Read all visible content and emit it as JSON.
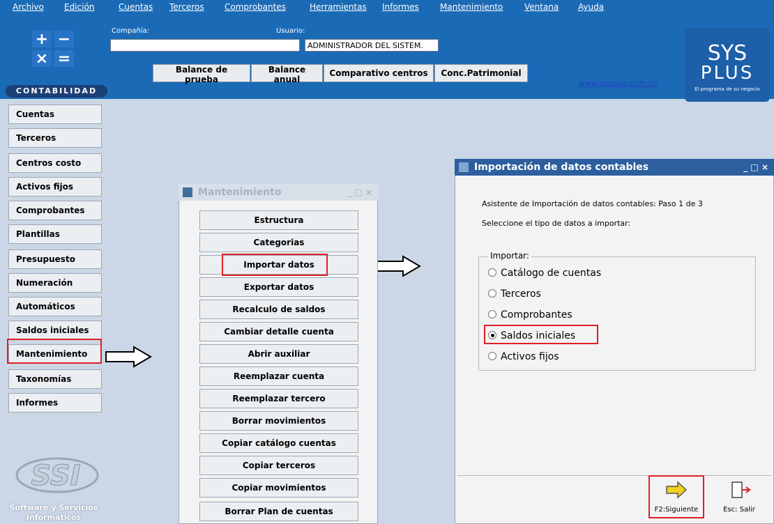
{
  "menubar": {
    "items": [
      "Archivo",
      "Edición",
      "Cuentas",
      "Terceros",
      "Comprobantes",
      "Herramientas",
      "Informes",
      "Mantenimiento",
      "Ventana",
      "Ayuda"
    ]
  },
  "header": {
    "company_label": "Compañía:",
    "user_label": "Usuario:",
    "company_value": "",
    "user_value": "ADMINISTRADOR DEL SISTEM.",
    "buttons": [
      "Balance de prueba",
      "Balance anual",
      "Comparativo centros",
      "Conc.Patrimonial"
    ],
    "link": "www.sysplus.com.co",
    "brand": {
      "sys": "SYS",
      "plus": "PLUS",
      "tag": "El programa de su negocio"
    }
  },
  "sidebar": {
    "section": "CONTABILIDAD",
    "items": [
      "Cuentas",
      "Terceros",
      "Centros costo",
      "Activos fijos",
      "Comprobantes",
      "Plantillas",
      "Presupuesto",
      "Numeración",
      "Automáticos",
      "Saldos iniciales",
      "Mantenimiento",
      "Taxonomías",
      "Informes"
    ],
    "footer_logo": "SSI",
    "footer_text1": "Software y Servicios",
    "footer_text2": "Informáticos"
  },
  "maint_window": {
    "title": "Mantenimiento",
    "buttons": [
      "Estructura",
      "Categorias",
      "Importar datos",
      "Exportar datos",
      "Recalculo de saldos",
      "Cambiar detalle cuenta",
      "Abrir auxiliar",
      "Reemplazar cuenta",
      "Reemplazar tercero",
      "Borrar movimientos",
      "Copiar catálogo cuentas",
      "Copiar terceros",
      "Copiar movimientos",
      "Borrar Plan de cuentas"
    ]
  },
  "import_window": {
    "title": "Importación de datos contables",
    "step_text": "Asistente de Importación de datos contables: Paso 1 de 3",
    "instruction": "Seleccione el tipo de datos a importar:",
    "group_label": "Importar:",
    "options": [
      "Catálogo de cuentas",
      "Terceros",
      "Comprobantes",
      "Saldos iniciales",
      "Activos fijos"
    ],
    "selected_option": "Saldos iniciales",
    "next_label": "F2:Siguiente",
    "exit_label": "Esc: Salir"
  },
  "colors": {
    "header_blue": "#1b6ab6",
    "panel_blue": "#cbd7e6",
    "title_blue": "#2d5f9e",
    "highlight_red": "#e01f26"
  }
}
